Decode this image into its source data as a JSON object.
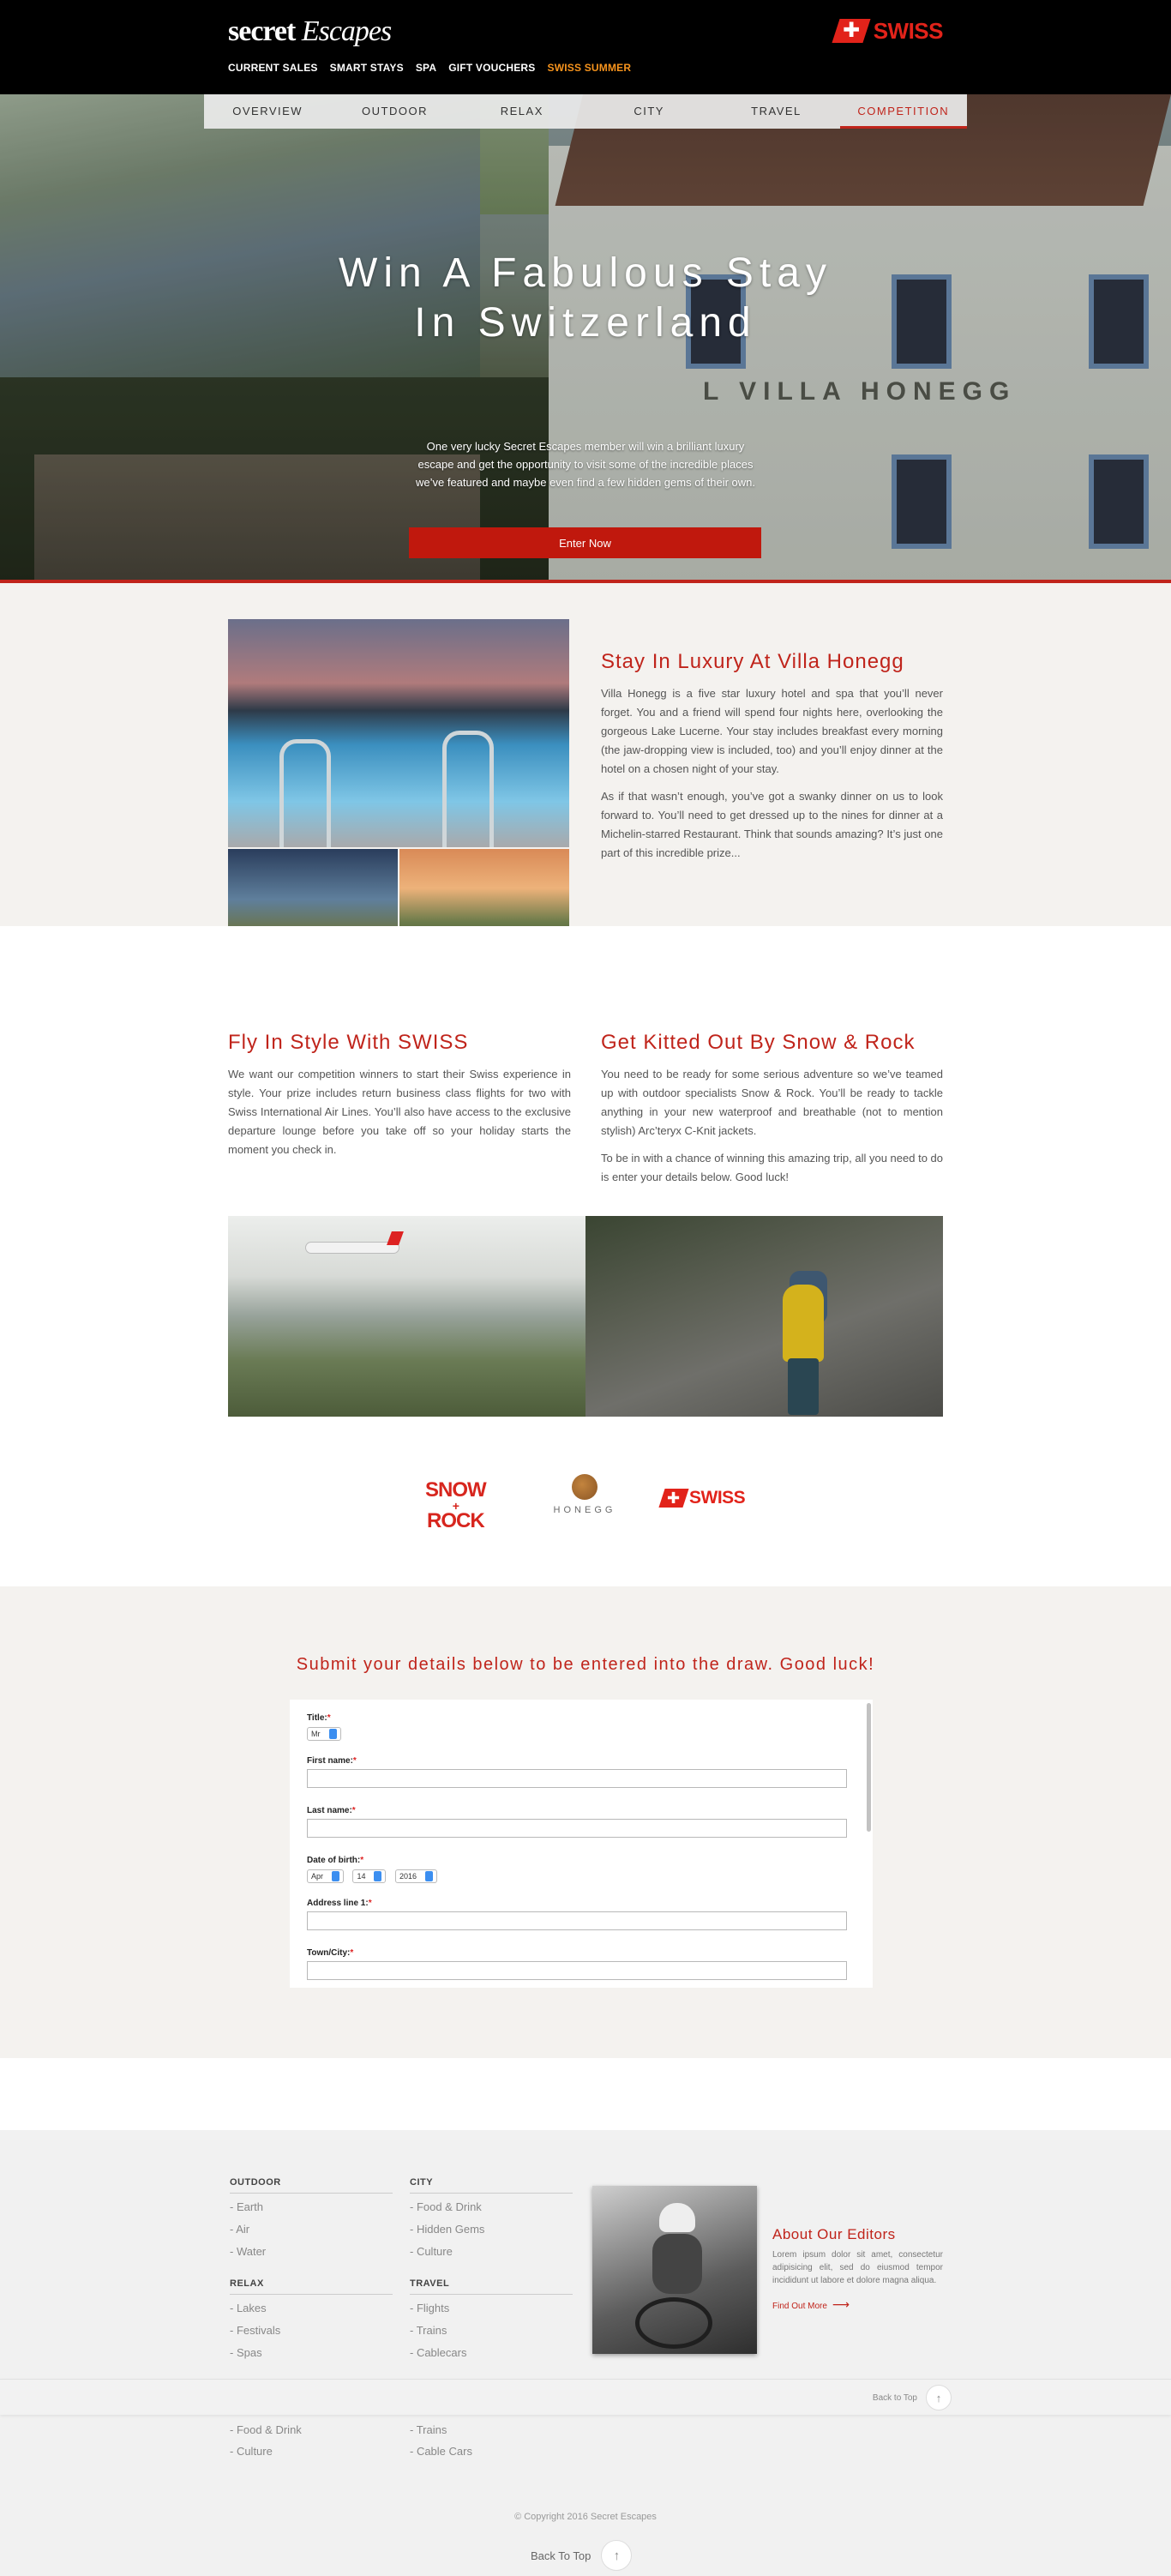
{
  "brand": {
    "logo_part1": "secret",
    "logo_part2": "Escapes",
    "partner_flag_symbol": "✚",
    "partner_name": "SWISS",
    "partner_color": "#e2231a"
  },
  "top_nav": {
    "items": [
      {
        "label": "CURRENT SALES"
      },
      {
        "label": "SMART STAYS"
      },
      {
        "label": "SPA"
      },
      {
        "label": "GIFT VOUCHERS"
      },
      {
        "label": "SWISS SUMMER",
        "active": true
      }
    ],
    "active_color": "#f7941d"
  },
  "sub_nav": {
    "items": [
      "OVERVIEW",
      "OUTDOOR",
      "RELAX",
      "CITY",
      "TRAVEL",
      "COMPETITION"
    ],
    "active": "COMPETITION"
  },
  "hero": {
    "title_line1": "Win A Fabulous Stay",
    "title_line2": "In Switzerland",
    "intro": "One very lucky Secret Escapes member will win a brilliant luxury escape and get the opportunity to visit some of the incredible places we’ve featured and maybe even find a few hidden gems of their own.",
    "cta_label": "Enter Now",
    "building_sign": "L  VILLA  HONEGG",
    "accent_color": "#c0241b"
  },
  "villa": {
    "heading": "Stay In Luxury At Villa Honegg",
    "para1": "Villa Honegg is a five star luxury hotel and spa that you’ll never forget. You and a friend will spend four nights here, overlooking the gorgeous Lake Lucerne. Your stay includes breakfast every morning (the jaw-dropping view is included, too) and you’ll enjoy dinner at the hotel on a chosen night of your stay.",
    "para2": "As if that wasn’t enough, you’ve got a swanky dinner on us to look forward to. You’ll need to get dressed up to the nines for dinner at a Michelin-starred Restaurant. Think that sounds amazing? It’s just one part of this incredible prize..."
  },
  "fly": {
    "heading": "Fly In Style With SWISS",
    "para1": "We want our competition winners to start their Swiss experience in style. Your prize includes return business class flights for two with Swiss International Air Lines. You’ll also have access to the exclusive departure lounge before you take off so your holiday starts the moment you check in."
  },
  "kit": {
    "heading": "Get Kitted Out By Snow & Rock",
    "para1": "You need to be ready for some serious adventure so we’ve teamed up with outdoor specialists Snow & Rock. You’ll be ready to tackle anything in your new waterproof and breathable (not to mention stylish) Arc’teryx C-Knit jackets.",
    "para2": "To be in with a chance of winning this amazing trip, all you need to do is enter your details below. Good luck!"
  },
  "partner_logos": {
    "snow_line1": "SNOW",
    "snow_amp": "+",
    "snow_line2": "ROCK",
    "honegg": "HONEGG",
    "swiss": "SWISS"
  },
  "form": {
    "heading": "Submit your details below to be entered into the draw. Good luck!",
    "required_mark": "*",
    "title_label": "Title:",
    "title_value": "Mr",
    "first_name_label": "First name:",
    "last_name_label": "Last name:",
    "dob_label": "Date of birth:",
    "dob_month": "Apr",
    "dob_day": "14",
    "dob_year": "2016",
    "address_label": "Address line 1:",
    "town_label": "Town/City:"
  },
  "footer": {
    "columns": [
      {
        "heading": "OUTDOOR",
        "links": [
          "- Earth",
          "- Air",
          "- Water"
        ]
      },
      {
        "heading": "CITY",
        "links": [
          "- Food & Drink",
          "- Hidden Gems",
          "- Culture"
        ]
      },
      {
        "heading": "RELAX",
        "links": [
          "- Lakes",
          "- Festivals",
          "- Spas"
        ]
      },
      {
        "heading": "TRAVEL",
        "links": [
          "- Flights",
          "- Trains",
          "- Cablecars"
        ]
      }
    ],
    "under_links_left": [
      "- Food & Drink",
      "- Culture"
    ],
    "under_links_right": [
      "- Trains",
      "- Cable Cars"
    ],
    "about_heading": "About Our Editors",
    "about_text": "Lorem ipsum dolor sit amet, consectetur adipisicing elit, sed do eiusmod tempor incididunt ut labore et dolore magna aliqua.",
    "about_link": "Find Out More",
    "about_arrow": "⟶",
    "back_to_top_small": "Back to Top",
    "back_to_top": "Back To Top",
    "up_arrow": "↑",
    "copyright": "© Copyright 2016 Secret Escapes"
  }
}
